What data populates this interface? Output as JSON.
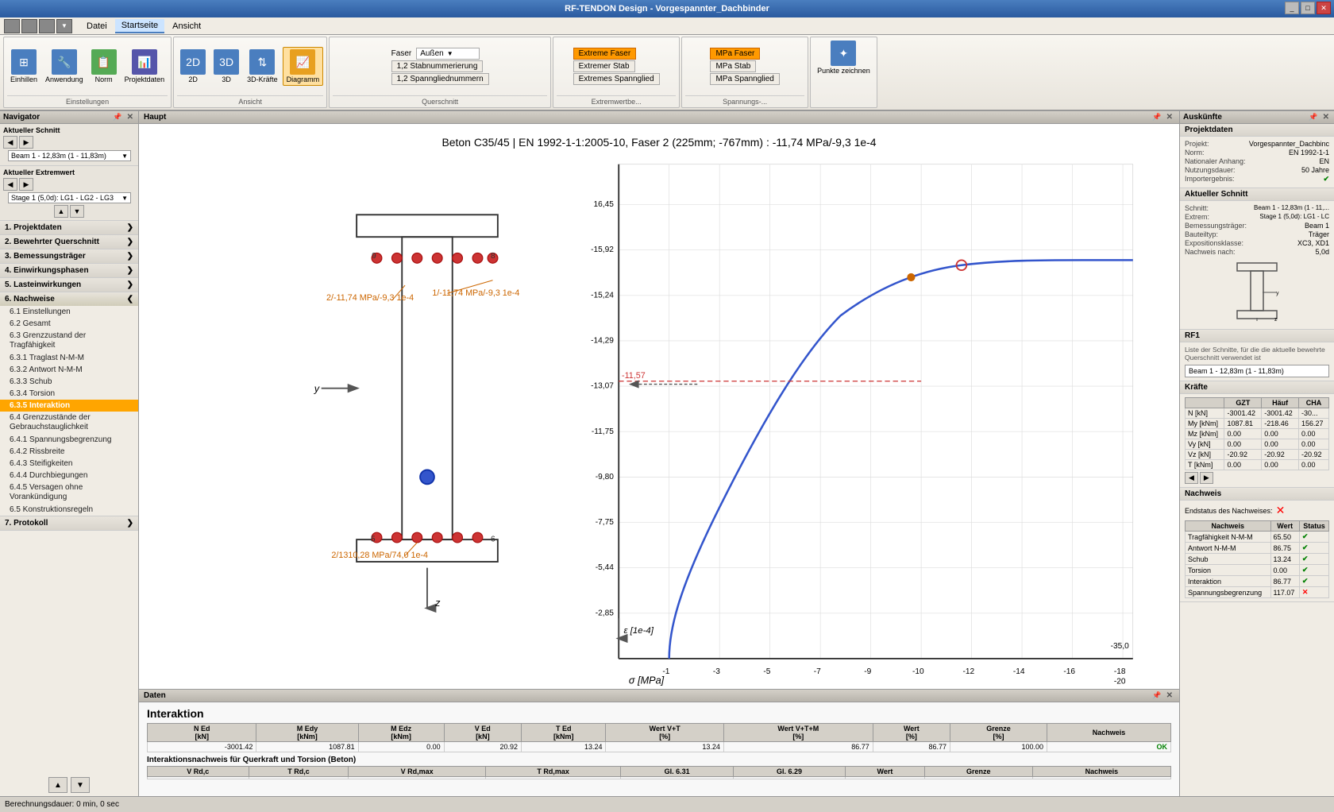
{
  "titlebar": {
    "title": "RF-TENDON Design - Vorgespannter_Dachbinder"
  },
  "menubar": {
    "items": [
      "Datei",
      "Startseite",
      "Ansicht"
    ]
  },
  "ribbon": {
    "groups": [
      {
        "label": "Einstellungen",
        "buttons": [
          "Einhillen",
          "Anwendung",
          "Norm",
          "Projektdaten"
        ]
      },
      {
        "label": "Ansicht",
        "buttons": [
          "2D",
          "3D",
          "3D-Kräfte",
          "Diagramm"
        ]
      },
      {
        "label": "Querschnitt"
      },
      {
        "label": "Extremwertbe..."
      },
      {
        "label": "Spannungs-..."
      }
    ],
    "faser_label": "Faser",
    "faser_dropdown": "Außen",
    "extreme_faser": "Extreme Faser",
    "extremer_stab": "Extremer Stab",
    "extremes_spannglied": "Extremes Spannglied",
    "stabnummerierung": "1,2 Stabnummerierung",
    "spannglied_nummern": "1,2 Spannglied­nummern",
    "mpa_faser": "MPa Faser",
    "mpa_stab": "MPa Stab",
    "mpa_spannglied": "MPa Spannglied",
    "punkte_zeichnen": "Punkte zeichnen"
  },
  "navigator": {
    "title": "Navigator",
    "current_section_label": "Aktueller Schnitt",
    "current_section_value": "Beam 1 - 12,83m (1 - 11,83m)",
    "current_extremwert_label": "Aktueller Extremwert",
    "current_extremwert_value": "Stage 1 (5,0d): LG1 - LG2 - LG3",
    "sections": [
      {
        "id": 1,
        "label": "1. Projektdaten",
        "expanded": false
      },
      {
        "id": 2,
        "label": "2. Bewehrter Querschnitt",
        "expanded": false
      },
      {
        "id": 3,
        "label": "3. Bemessungsträger",
        "expanded": false
      },
      {
        "id": 4,
        "label": "4. Einwirkungsphasen",
        "expanded": false
      },
      {
        "id": 5,
        "label": "5. Lasteinwirkungen",
        "expanded": false
      },
      {
        "id": 6,
        "label": "6. Nachweise",
        "expanded": true,
        "children": [
          "6.1 Einstellungen",
          "6.2 Gesamt",
          "6.3 Grenzzustand der Tragfähigkeit",
          "6.3.1 Traglast N-M-M",
          "6.3.2 Antwort N-M-M",
          "6.3.3 Schub",
          "6.3.4 Torsion",
          "6.3.5 Interaktion",
          "6.4 Grenzzustände der Gebrauchstauglichkeit",
          "6.4.1 Spannungsbegrenzung",
          "6.4.2 Rissbreite",
          "6.4.3 Steifigkeiten",
          "6.4.4 Durchbiegungen",
          "6.4.5 Versagen ohne Vorankündigung",
          "6.5 Konstruktionsregeln"
        ]
      },
      {
        "id": 7,
        "label": "7. Protokoll",
        "expanded": false
      }
    ]
  },
  "haupt": {
    "title": "Haupt",
    "chart_title": "Beton C35/45 | EN 1992-1-1:2005-10, Faser 2 (225mm; -767mm) : -11,74 MPa/-9,3 1e-4",
    "annotation1": "2/-11,74 MPa/-9,3 1e-4",
    "annotation2": "1/-11,74 MPa/-9,3 1e-4",
    "annotation3": "2/1310,28 MPa/74,0 1e-4",
    "y_axis_label": "ε [1e-4]",
    "x_axis_label": "σ [MPa]",
    "x_values": [
      "-1",
      "-3",
      "-5",
      "-7",
      "-9",
      "-10",
      "-12",
      "-14",
      "-16",
      "-18",
      "-20",
      "-35,0"
    ],
    "y_values": [
      "16,45",
      "-15,92",
      "-15,24",
      "-14,29",
      "-13,07",
      "-11,75",
      "-9,80",
      "-7,75",
      "-5,44",
      "-2,85"
    ],
    "dashed_line_value": "-11,57"
  },
  "data_panel": {
    "title": "Daten",
    "section_title": "Interaktion",
    "table_headers": [
      "N Ed\n[kN]",
      "M Edy\n[kNm]",
      "M Edz\n[kNm]",
      "V Ed\n[kN]",
      "T Ed\n[kNm]",
      "Wert V+T\n[%]",
      "Wert V+T+M\n[%]",
      "Wert\n[%]",
      "Grenze\n[%]",
      "Nachweis"
    ],
    "table_row": [
      "-3001.42",
      "1087.81",
      "0.00",
      "20.92",
      "13.24",
      "13.24",
      "86.77",
      "86.77",
      "100.00",
      "OK"
    ],
    "subtitle2": "Interaktionsnachweis für Querkraft und Torsion (Beton)",
    "table2_headers": [
      "V Rd,c",
      "T Rd,c",
      "V Rd,max",
      "T Rd,max",
      "Gl. 6.31",
      "Gl. 6.29",
      "Wert",
      "Grenze",
      "Nachweis"
    ]
  },
  "auskuenfte": {
    "title": "Auskünfte",
    "project_section": "Projektdaten",
    "projekt_label": "Projekt:",
    "projekt_value": "Vorgespannter_Dachbinc",
    "norm_label": "Norm:",
    "norm_value": "EN 1992-1-1",
    "nationaler_anhang_label": "Nationaler Anhang:",
    "nationaler_anhang_value": "EN",
    "nutzungsdauer_label": "Nutzungsdauer:",
    "nutzungsdauer_value": "50 Jahre",
    "importergebnis_label": "Importergebnis:",
    "current_section": "Aktueller Schnitt",
    "schnitt_label": "Schnitt:",
    "schnitt_value": "Beam 1 - 12,83m (1 - 11,...",
    "extrem_label": "Extrem:",
    "extrem_value": "Stage 1 (5,0d): LG1 - LC",
    "bemessungstraeger_label": "Bemessungsträger:",
    "bemessungstraeger_value": "Beam 1",
    "bauteiltyp_label": "Bauteiltyp:",
    "bauteiltyp_value": "Träger",
    "expositionsklasse_label": "Expositionsklasse:",
    "expositionsklasse_value": "XC3, XD1",
    "nachweis_nach_label": "Nachweis nach:",
    "nachweis_nach_value": "5,0d",
    "rf1_section": "RF1",
    "rf1_description": "Liste der Schnitte, für die die aktuelle bewehrte Querschnitt verwendet ist",
    "rf1_beam": "Beam 1 - 12,83m (1 - 11,83m)",
    "kraefte_section": "Kräfte",
    "kraefte_headers": [
      "",
      "GZT",
      "Häuf",
      "CHA"
    ],
    "kraefte_rows": [
      {
        "label": "N [kN]",
        "gzt": "-3001.42",
        "hauf": "-3001.42",
        "cha": "-30..."
      },
      {
        "label": "My [kNm]",
        "gzt": "1087.81",
        "hauf": "-218.46",
        "cha": "156.27"
      },
      {
        "label": "Mz [kNm]",
        "gzt": "0.00",
        "hauf": "0.00",
        "cha": "0.00"
      },
      {
        "label": "Vy [kN]",
        "gzt": "0.00",
        "hauf": "0.00",
        "cha": "0.00"
      },
      {
        "label": "Vz [kN]",
        "gzt": "-20.92",
        "hauf": "-20.92",
        "cha": "-20.92"
      },
      {
        "label": "T [kNm]",
        "gzt": "0.00",
        "hauf": "0.00",
        "cha": "0.00"
      }
    ],
    "nachweis_section": "Nachweis",
    "endstatus_label": "Endstatus des Nachweises:",
    "nachweis_rows": [
      {
        "name": "Tragfähigkeit N-M-M",
        "wert": "65.50",
        "status": "ok"
      },
      {
        "name": "Antwort N-M-M",
        "wert": "86.75",
        "status": "ok"
      },
      {
        "name": "Schub",
        "wert": "13.24",
        "status": "ok"
      },
      {
        "name": "Torsion",
        "wert": "0.00",
        "status": "ok"
      },
      {
        "name": "Interaktion",
        "wert": "86.77",
        "status": "ok"
      },
      {
        "name": "Spannungsbegrenzung",
        "wert": "117.07",
        "status": "fail"
      }
    ]
  },
  "statusbar": {
    "text": "Berechnungsdauer: 0 min, 0 sec"
  }
}
